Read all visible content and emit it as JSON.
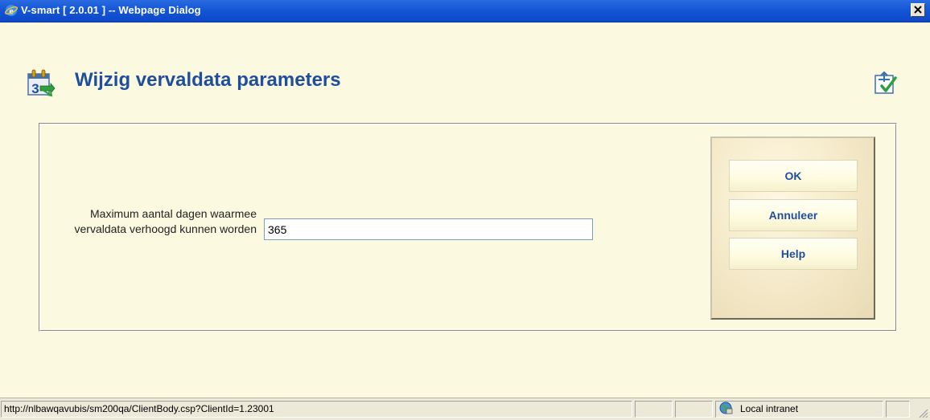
{
  "window": {
    "title": "V-smart [ 2.0.01 ] -- Webpage Dialog"
  },
  "page": {
    "title": "Wijzig vervaldata parameters"
  },
  "form": {
    "field_label": "Maximum aantal dagen waarmee vervaldata verhoogd kunnen worden",
    "field_value": "365"
  },
  "buttons": {
    "ok": "OK",
    "cancel": "Annuleer",
    "help": "Help"
  },
  "statusbar": {
    "url": "http://nlbawqavubis/sm200qa/ClientBody.csp?ClientId=1.23001",
    "zone": "Local intranet"
  },
  "icons": {
    "app": "ie-icon",
    "close": "close-icon",
    "page": "calendar-icon",
    "help": "help-icon",
    "zone": "globe-icon"
  },
  "colors": {
    "title_text": "#1F4E9E",
    "page_bg": "#FBFAE0",
    "titlebar": "#1457D6"
  }
}
